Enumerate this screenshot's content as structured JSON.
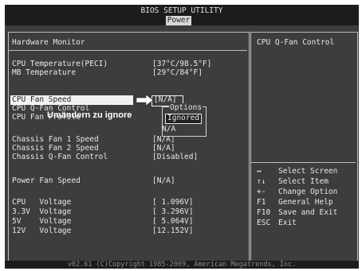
{
  "header": {
    "title": "BIOS SETUP UTILITY",
    "tab": "Power"
  },
  "left": {
    "section_title": "Hardware Monitor",
    "rows": [
      {
        "label": "CPU Temperature(PECI)",
        "value": "[37°C/98.5°F]"
      },
      {
        "label": "MB Temperature",
        "value": "[29°C/84°F]"
      },
      {
        "label": "CPU Fan Speed",
        "value": "[N/A]"
      },
      {
        "label": "CPU Q-Fan Control",
        "value": ""
      },
      {
        "label": "CPU Fan Profile",
        "value": ""
      },
      {
        "label": "Chassis Fan 1 Speed",
        "value": "[N/A]"
      },
      {
        "label": "Chassis Fan 2 Speed",
        "value": "[N/A]"
      },
      {
        "label": "Chassis Q-Fan Control",
        "value": "[Disabled]"
      },
      {
        "label": "Power Fan Speed",
        "value": "[N/A]"
      },
      {
        "label": "CPU   Voltage",
        "value": "[ 1.096V]"
      },
      {
        "label": "3.3V  Voltage",
        "value": "[ 3.296V]"
      },
      {
        "label": "5V    Voltage",
        "value": "[ 5.064V]"
      },
      {
        "label": "12V   Voltage",
        "value": "[12.152V]"
      }
    ]
  },
  "options_popup": {
    "title": "Options",
    "items": [
      "Ignored",
      "N/A"
    ]
  },
  "annotation": {
    "text": "Umändern zu ignore"
  },
  "right": {
    "help_title": "CPU Q-Fan Control",
    "keys": [
      {
        "key": "↔",
        "desc": "Select Screen"
      },
      {
        "key": "↑↓",
        "desc": "Select Item"
      },
      {
        "key": "+-",
        "desc": "Change Option"
      },
      {
        "key": "F1",
        "desc": "General Help"
      },
      {
        "key": "F10",
        "desc": "Save and Exit"
      },
      {
        "key": "ESC",
        "desc": "Exit"
      }
    ]
  },
  "footer": {
    "copyright": "v02.61 (C)Copyright 1985-2009, American Megatrends, Inc."
  },
  "colors": {
    "background": "#3d3d3d",
    "text": "#e8e8e8",
    "highlight": "#f2f2f2",
    "bar": "#1c1c1c"
  }
}
